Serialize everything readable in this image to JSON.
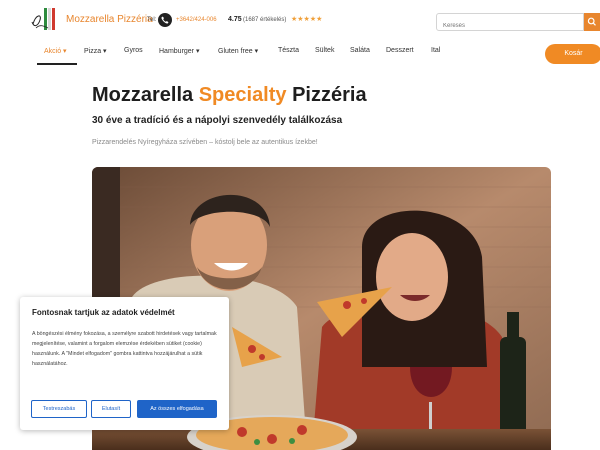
{
  "header": {
    "brand": "Mozzarella Pizzéria",
    "tel_label": "Tel:",
    "phone": "+3642/424-006",
    "rating_value": "4.75",
    "rating_count": "(1687 értékelés)",
    "stars": "★★★★★",
    "search_placeholder": "Keresés"
  },
  "nav": {
    "items": [
      {
        "label": "Akció ▾"
      },
      {
        "label": "Pizza ▾"
      },
      {
        "label": "Gyros"
      },
      {
        "label": "Hamburger ▾"
      },
      {
        "label": "Gluten free ▾"
      },
      {
        "label": "Tészta"
      },
      {
        "label": "Sültek"
      },
      {
        "label": "Saláta"
      },
      {
        "label": "Desszert"
      },
      {
        "label": "Ital"
      }
    ],
    "order_label": "Kosár"
  },
  "hero": {
    "title_part1": "Mozzarella ",
    "title_accent": "Specialty",
    "title_part2": " Pizzéria",
    "subtitle": "30 éve a tradíció és a nápolyi szenvedély találkozása",
    "intro": "Pizzarendelés Nyíregyháza szívében – kóstolj bele az autentikus ízekbe!"
  },
  "cookie": {
    "title": "Fontosnak tartjuk az adatok védelmét",
    "text": "A böngészési élmény fokozása, a személyre szabott hirdetések vagy tartalmak megjelenítése, valamint a forgalom elemzése érdekében sütiket (cookie) használunk. A \"Mindet elfogadom\" gombra kattintva hozzájárulhat a sütik használatához.",
    "btn_customize": "Testreszabás",
    "btn_reject": "Elutasít",
    "btn_accept": "Az összes elfogadása"
  },
  "colors": {
    "accent": "#f08a24",
    "primary_blue": "#1f64c8"
  }
}
